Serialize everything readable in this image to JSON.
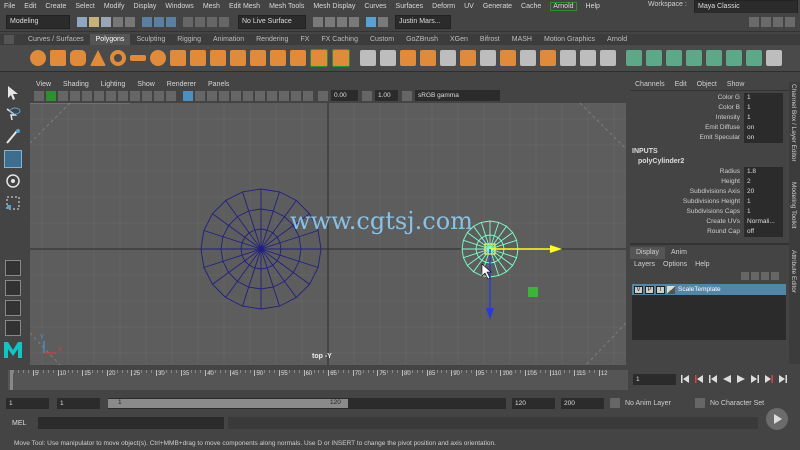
{
  "menubar": [
    "File",
    "Edit",
    "Create",
    "Select",
    "Modify",
    "Display",
    "Windows",
    "Mesh",
    "Edit Mesh",
    "Mesh Tools",
    "Mesh Display",
    "Curves",
    "Surfaces",
    "Deform",
    "UV",
    "Generate",
    "Cache",
    "Arnold",
    "Help"
  ],
  "workspace": {
    "label": "Workspace :",
    "value": "Maya Classic"
  },
  "status": {
    "mode": "Modeling",
    "live": "No Live Surface",
    "user": "Justin Mars..."
  },
  "shelf_tabs": [
    "Curves / Surfaces",
    "Polygons",
    "Sculpting",
    "Rigging",
    "Animation",
    "Rendering",
    "FX",
    "FX Caching",
    "Custom",
    "GoZBrush",
    "XGen",
    "Bifrost",
    "MASH",
    "Motion Graphics",
    "Arnold"
  ],
  "shelf_active": "Polygons",
  "panel_menu": [
    "View",
    "Shading",
    "Lighting",
    "Show",
    "Renderer",
    "Panels"
  ],
  "panel_toolbar": {
    "near": "0.00",
    "far": "1.00",
    "color_space": "sRGB gamma"
  },
  "viewport": {
    "camera_label": "top -Y",
    "watermark": "www.cgtsj.com",
    "axis_x": "X",
    "axis_y": "Y"
  },
  "channel_box": {
    "menus": [
      "Channels",
      "Edit",
      "Object",
      "Show"
    ],
    "attrs": [
      {
        "k": "Color G",
        "v": "1"
      },
      {
        "k": "Color B",
        "v": "1"
      },
      {
        "k": "Intensity",
        "v": "1"
      },
      {
        "k": "Emit Diffuse",
        "v": "on"
      },
      {
        "k": "Emit Specular",
        "v": "on"
      }
    ],
    "inputs_label": "INPUTS",
    "node": "polyCylinder2",
    "inputs": [
      {
        "k": "Radius",
        "v": "1.8"
      },
      {
        "k": "Height",
        "v": "2"
      },
      {
        "k": "Subdivisions Axis",
        "v": "20"
      },
      {
        "k": "Subdivisions Height",
        "v": "1"
      },
      {
        "k": "Subdivisions Caps",
        "v": "1"
      },
      {
        "k": "Create UVs",
        "v": "Normali..."
      },
      {
        "k": "Round Cap",
        "v": "off"
      }
    ]
  },
  "layer_editor": {
    "tabs": [
      "Display",
      "Anim"
    ],
    "menus": [
      "Layers",
      "Options",
      "Help"
    ],
    "flags": [
      "V",
      "P",
      "T"
    ],
    "layer_name": "ScaleTemplate"
  },
  "side_tabs": [
    "Channel Box / Layer Editor",
    "Modeling Toolkit",
    "Attribute Editor"
  ],
  "timeline": {
    "ticks": [
      "5",
      "10",
      "15",
      "20",
      "25",
      "30",
      "35",
      "40",
      "45",
      "50",
      "55",
      "60",
      "65",
      "70",
      "75",
      "80",
      "85",
      "90",
      "95",
      "100",
      "105",
      "110",
      "115",
      "12"
    ],
    "current": "1"
  },
  "range": {
    "start": "1",
    "start2": "1",
    "slider_start": "1",
    "slider_end": "120",
    "end": "120",
    "end2": "200",
    "anim_layer": "No Anim Layer",
    "char_set": "No Character Set"
  },
  "cmdline": {
    "label": "MEL"
  },
  "help_line": "Move Tool: Use manipulator to move object(s). Ctrl+MMB+drag to move components along normals. Use D or INSERT to change the pivot position and axis orientation.",
  "colors": {
    "accent_blue": "#5285a6",
    "wire_dark": "#202080",
    "wire_select": "#7dffc8",
    "maya_cyan": "#13c4c4"
  }
}
